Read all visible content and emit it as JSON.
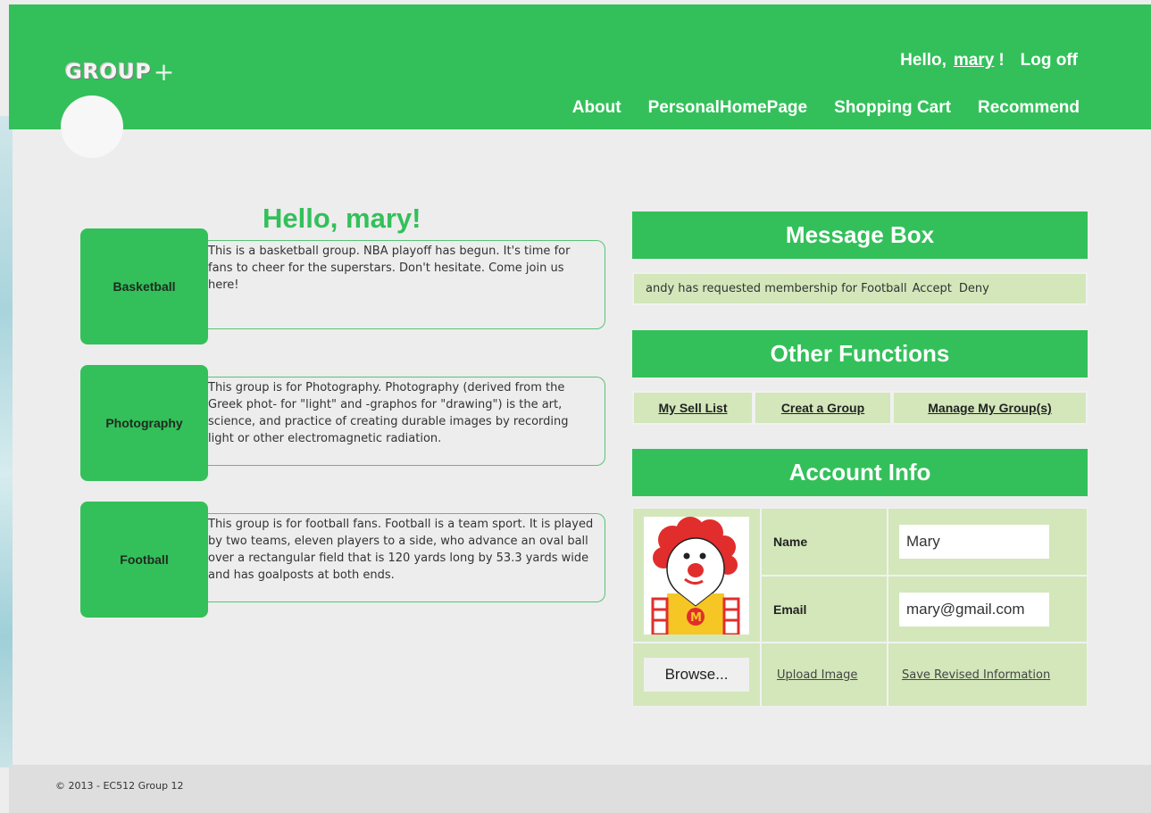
{
  "header": {
    "logo_text": "GROUP",
    "logo_plus": "+",
    "hello_prefix": "Hello,",
    "username": "mary",
    "hello_suffix": "!",
    "logoff": "Log off",
    "nav": [
      "About",
      "PersonalHomePage",
      "Shopping Cart",
      "Recommend"
    ]
  },
  "greeting": "Hello, mary!",
  "groups": [
    {
      "name": "Basketball",
      "description": "This is a basketball group. NBA playoff has begun. It's time for fans to cheer for the superstars. Don't hesitate. Come join us here!"
    },
    {
      "name": "Photography",
      "description": "This group is for Photography. Photography (derived from the Greek phot- for \"light\" and -graphos for \"drawing\") is the art, science, and practice of creating durable images by recording light or other electromagnetic radiation."
    },
    {
      "name": "Football",
      "description": "This group is for football fans. Football is a team sport. It is played by two teams, eleven players to a side, who advance an oval ball over a rectangular field that is 120 yards long by 53.3 yards wide and has goalposts at both ends."
    }
  ],
  "message_box": {
    "title": "Message Box",
    "message": "andy has requested membership for Football",
    "accept": "Accept",
    "deny": "Deny"
  },
  "other_functions": {
    "title": "Other Functions",
    "items": [
      "My Sell List",
      "Creat a Group",
      "Manage My Group(s)"
    ]
  },
  "account_info": {
    "title": "Account Info",
    "name_label": "Name",
    "name_value": "Mary",
    "email_label": "Email",
    "email_value": "mary@gmail.com",
    "browse_label": "Browse...",
    "upload_label": "Upload Image",
    "save_label": "Save Revised Information"
  },
  "footer": {
    "copyright": "© 2013 - EC512 Group 12"
  },
  "colors": {
    "brand_green": "#33c05a",
    "panel_light_green": "#d3e7bb",
    "background": "#ededed"
  }
}
